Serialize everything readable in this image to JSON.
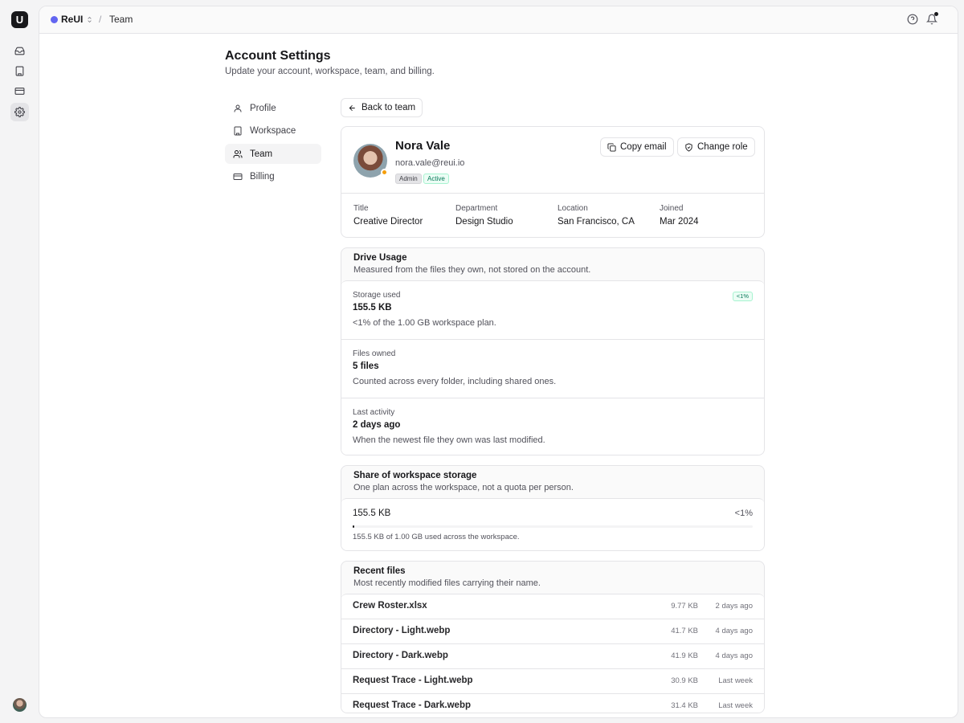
{
  "app": {
    "logo_letter": "U"
  },
  "topbar": {
    "workspace": "ReUI",
    "workspace_color": "#6366f1",
    "breadcrumb_separator": "/",
    "breadcrumb_current": "Team"
  },
  "header": {
    "title": "Account Settings",
    "subtitle": "Update your account, workspace, team, and billing."
  },
  "nav": {
    "items": [
      {
        "label": "Profile",
        "icon": "user-icon"
      },
      {
        "label": "Workspace",
        "icon": "building-icon"
      },
      {
        "label": "Team",
        "icon": "users-icon",
        "active": true
      },
      {
        "label": "Billing",
        "icon": "credit-card-icon"
      }
    ]
  },
  "back_label": "Back to team",
  "member": {
    "name": "Nora Vale",
    "email": "nora.vale@reui.io",
    "role_badge": "Admin",
    "status_badge": "Active",
    "copy_email_label": "Copy email",
    "change_role_label": "Change role",
    "meta": [
      {
        "label": "Title",
        "value": "Creative Director"
      },
      {
        "label": "Department",
        "value": "Design Studio"
      },
      {
        "label": "Location",
        "value": "San Francisco, CA"
      },
      {
        "label": "Joined",
        "value": "Mar 2024"
      }
    ]
  },
  "drive": {
    "title": "Drive Usage",
    "subtitle": "Measured from the files they own, not stored on the account.",
    "stats": [
      {
        "label": "Storage used",
        "value": "155.5 KB",
        "desc": "<1% of the 1.00 GB workspace plan.",
        "badge": "<1%"
      },
      {
        "label": "Files owned",
        "value": "5 files",
        "desc": "Counted across every folder, including shared ones."
      },
      {
        "label": "Last activity",
        "value": "2 days ago",
        "desc": "When the newest file they own was last modified."
      }
    ]
  },
  "share": {
    "title": "Share of workspace storage",
    "subtitle": "One plan across the workspace, not a quota per person.",
    "used": "155.5 KB",
    "percent_label": "<1%",
    "fill_fraction": 0.002,
    "caption": "155.5 KB of 1.00 GB used across the workspace."
  },
  "recent": {
    "title": "Recent files",
    "subtitle": "Most recently modified files carrying their name.",
    "files": [
      {
        "name": "Crew Roster.xlsx",
        "size": "9.77 KB",
        "time": "2 days ago"
      },
      {
        "name": "Directory - Light.webp",
        "size": "41.7 KB",
        "time": "4 days ago"
      },
      {
        "name": "Directory - Dark.webp",
        "size": "41.9 KB",
        "time": "4 days ago"
      },
      {
        "name": "Request Trace - Light.webp",
        "size": "30.9 KB",
        "time": "Last week"
      },
      {
        "name": "Request Trace - Dark.webp",
        "size": "31.4 KB",
        "time": "Last week"
      }
    ]
  }
}
